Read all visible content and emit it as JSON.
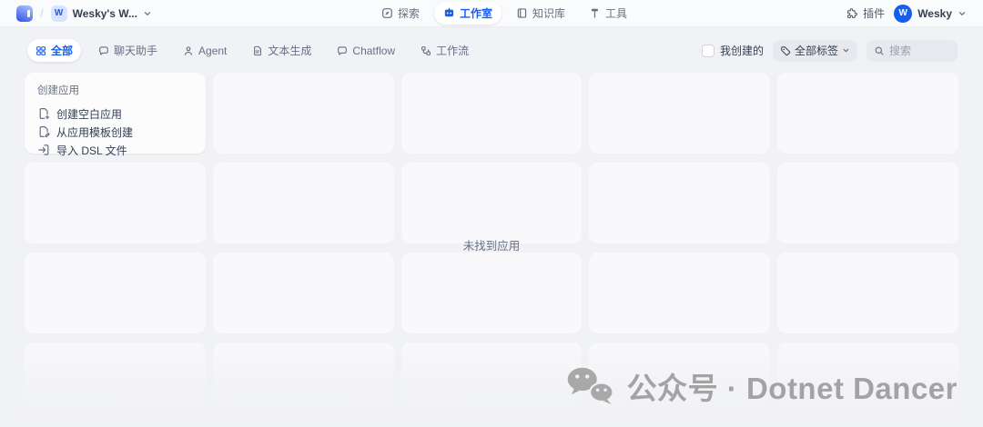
{
  "header": {
    "workspace_badge": "W",
    "workspace_name": "Wesky's W...",
    "nav_items": [
      {
        "icon": "compass-icon",
        "label": "探索",
        "active": false
      },
      {
        "icon": "robot-icon",
        "label": "工作室",
        "active": true
      },
      {
        "icon": "book-icon",
        "label": "知识库",
        "active": false
      },
      {
        "icon": "hammer-icon",
        "label": "工具",
        "active": false
      }
    ],
    "plugins_label": "插件",
    "user": {
      "initial": "W",
      "name": "Wesky"
    }
  },
  "toolbar": {
    "tabs": [
      {
        "icon": "grid-icon",
        "label": "全部",
        "active": true
      },
      {
        "icon": "chat-icon",
        "label": "聊天助手",
        "active": false
      },
      {
        "icon": "agent-icon",
        "label": "Agent",
        "active": false
      },
      {
        "icon": "doc-icon",
        "label": "文本生成",
        "active": false
      },
      {
        "icon": "chat-icon",
        "label": "Chatflow",
        "active": false
      },
      {
        "icon": "workflow-icon",
        "label": "工作流",
        "active": false
      }
    ],
    "created_by_me": {
      "label": "我创建的",
      "checked": false
    },
    "tag_filter": {
      "icon": "tag-icon",
      "label": "全部标签"
    },
    "search": {
      "icon": "search-icon",
      "placeholder": "搜索"
    }
  },
  "create_card": {
    "title": "创建应用",
    "items": [
      {
        "icon": "file-plus-icon",
        "label": "创建空白应用"
      },
      {
        "icon": "file-template-icon",
        "label": "从应用模板创建"
      },
      {
        "icon": "file-import-icon",
        "label": "导入 DSL 文件"
      }
    ]
  },
  "grid": {
    "columns": 5,
    "rows": 4,
    "placeholder_count": 19
  },
  "empty_state": {
    "text": "未找到应用"
  },
  "watermark": {
    "icon": "wechat-icon",
    "text": "公众号 · Dotnet Dancer"
  },
  "colors": {
    "accent": "#155eef",
    "page_bg": "#f1f2f6",
    "card_bg": "#f7f8fa",
    "avatar_bg": "#155eef"
  }
}
